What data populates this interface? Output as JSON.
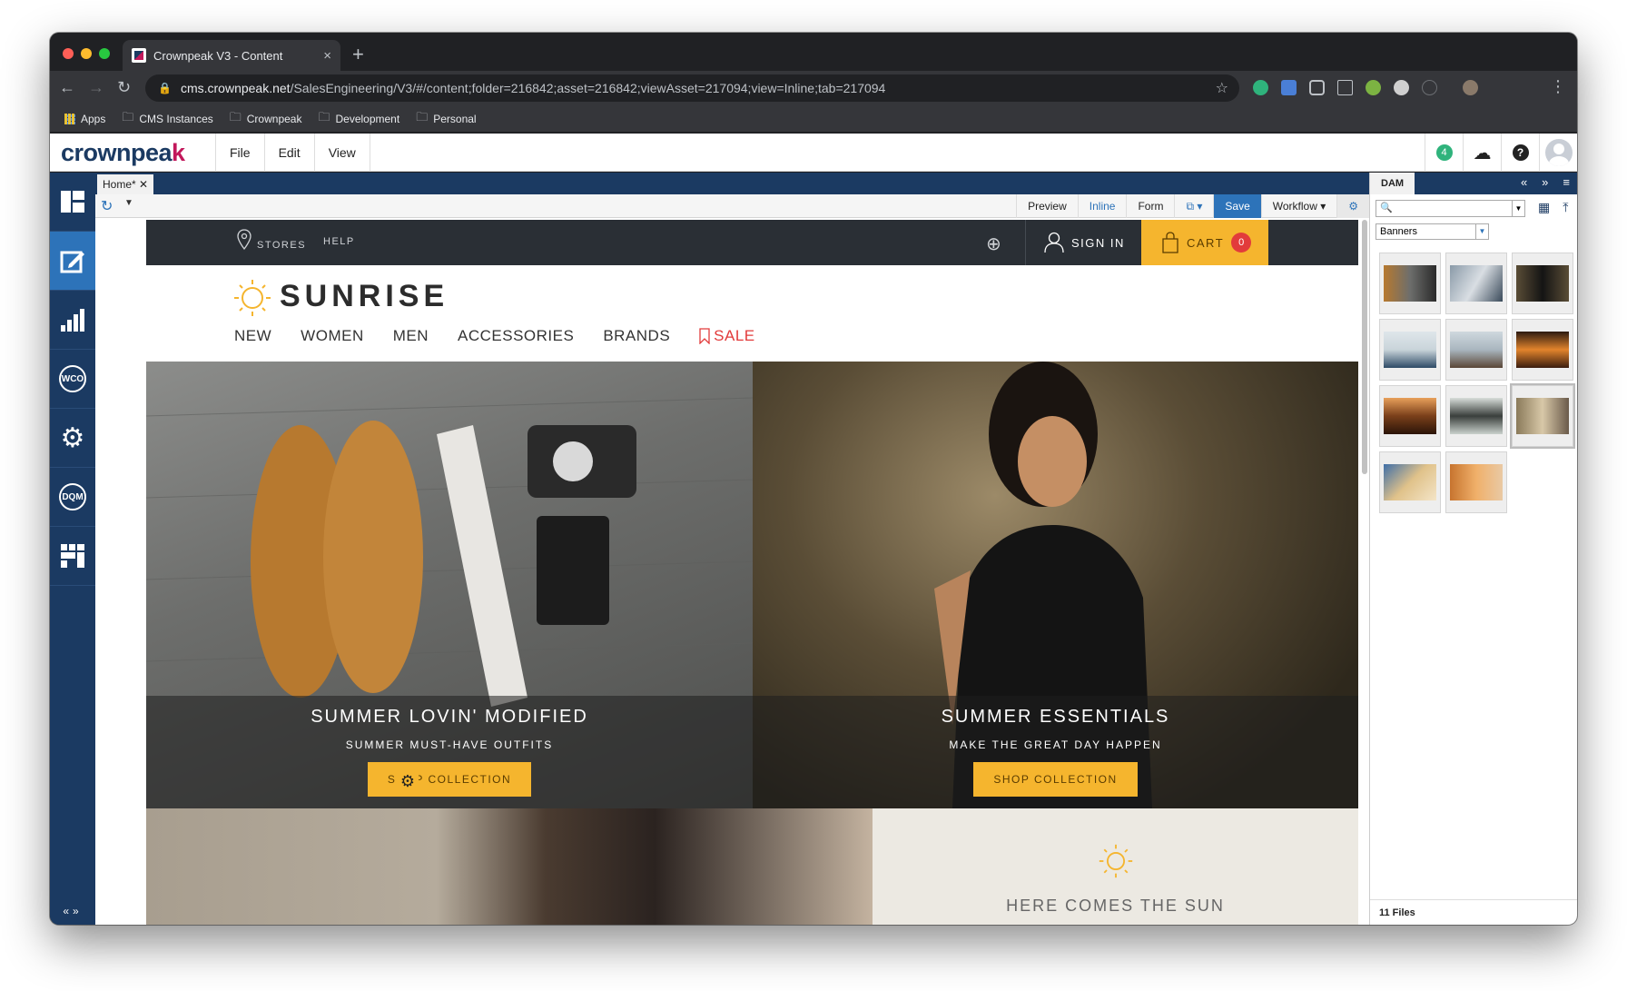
{
  "browser": {
    "tab_title": "Crownpeak V3 - Content",
    "url_domain": "cms.crownpeak.net",
    "url_path": "/SalesEngineering/V3/#/content;folder=216842;asset=216842;viewAsset=217094;view=Inline;tab=217094",
    "bookmarks": [
      "Apps",
      "CMS Instances",
      "Crownpeak",
      "Development",
      "Personal"
    ]
  },
  "cms": {
    "logo_main": "crownpea",
    "logo_accent": "k",
    "menus": [
      "File",
      "Edit",
      "View"
    ],
    "notification_count": "4",
    "doc_tab": "Home*",
    "view_modes": [
      "Preview",
      "Inline",
      "Form"
    ],
    "save_label": "Save",
    "workflow_label": "Workflow",
    "left_nav": [
      "dashboard",
      "edit",
      "reports",
      "WCO",
      "settings",
      "DQM",
      "widgets"
    ]
  },
  "site": {
    "stores": "STORES",
    "help": "HELP",
    "sign_in": "SIGN IN",
    "cart": "CART",
    "cart_count": "0",
    "brand": "SUNRISE",
    "nav": [
      "NEW",
      "WOMEN",
      "MEN",
      "ACCESSORIES",
      "BRANDS",
      "SALE"
    ],
    "hero1": {
      "title": "SUMMER LOVIN' MODIFIED",
      "subtitle": "SUMMER MUST-HAVE OUTFITS",
      "button": "SHOP COLLECTION"
    },
    "hero2": {
      "title": "SUMMER ESSENTIALS",
      "subtitle": "MAKE THE GREAT DAY HAPPEN",
      "button": "SHOP COLLECTION"
    },
    "lower_title": "HERE COMES THE SUN"
  },
  "dam": {
    "title": "DAM",
    "folder": "Banners",
    "file_count": "11 Files",
    "thumbs": [
      "shoes",
      "desk",
      "woman-black",
      "woman-portrait",
      "man-beach",
      "sunset-pier",
      "summer-banner",
      "sunglasses",
      "woman-sunglasses",
      "beach-feet",
      "sunset-hands"
    ]
  },
  "colors": {
    "navy": "#1b3a62",
    "accent": "#c2185b",
    "blue": "#2d73b9",
    "yellow": "#f5b52e",
    "red": "#e23b3b"
  }
}
